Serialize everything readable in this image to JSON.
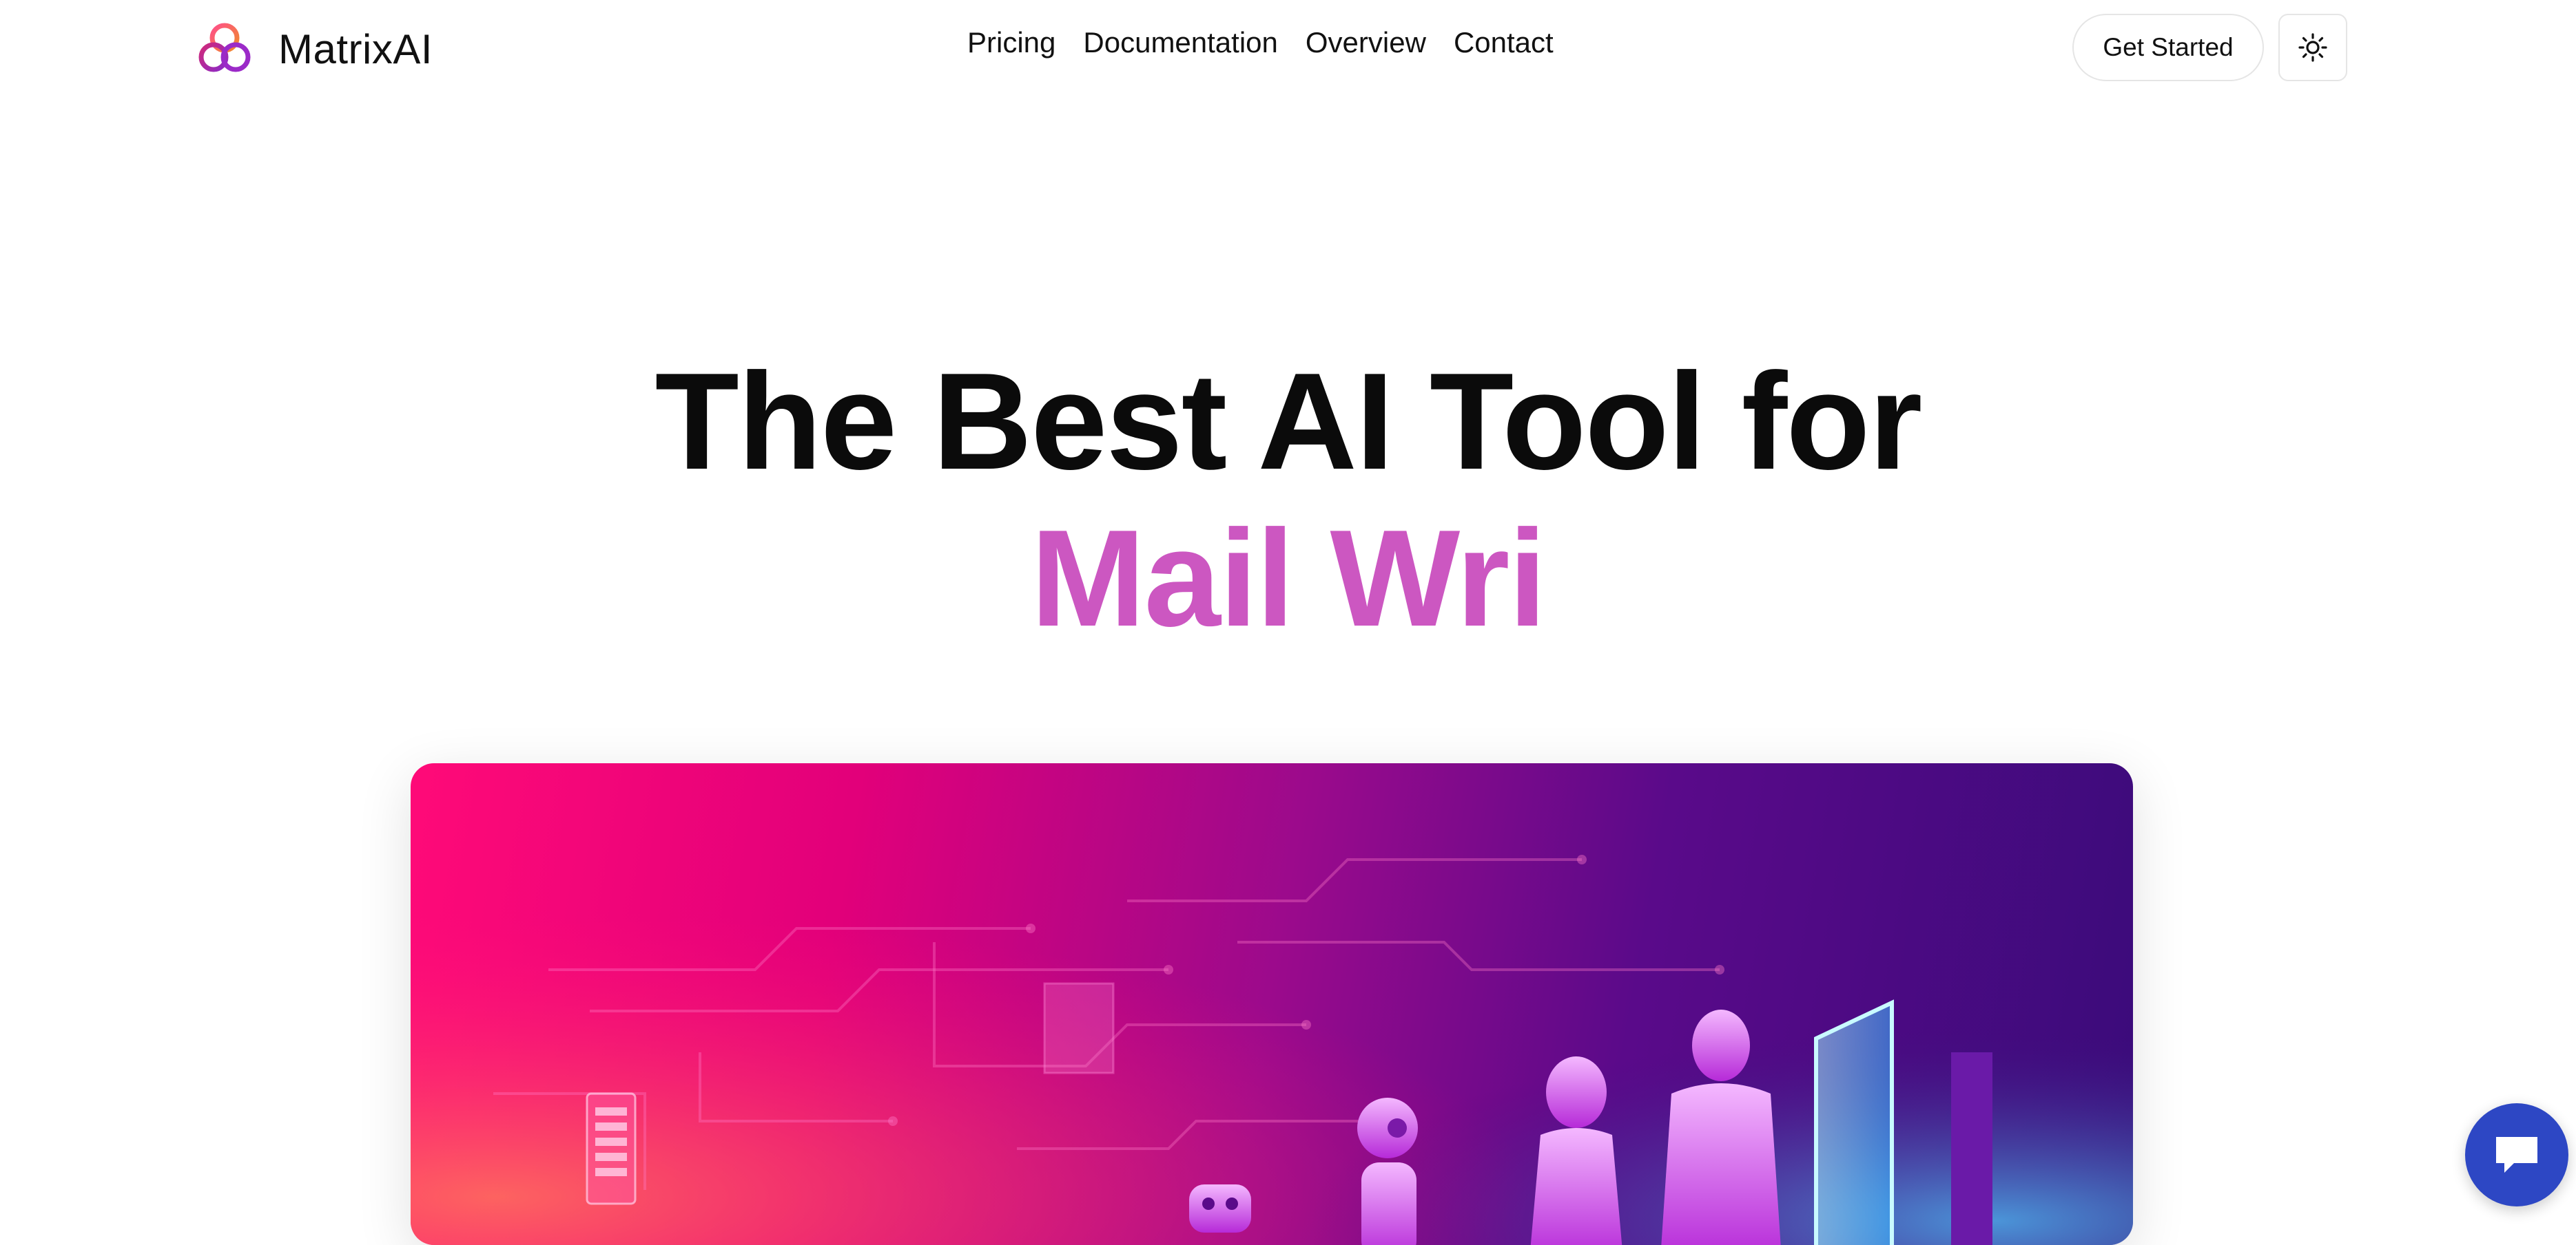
{
  "brand": {
    "name": "MatrixAI"
  },
  "nav": {
    "items": [
      "Pricing",
      "Documentation",
      "Overview",
      "Contact"
    ]
  },
  "header": {
    "cta_label": "Get Started"
  },
  "hero": {
    "line1": "The Best AI Tool for",
    "line2": "Mail Wri"
  },
  "colors": {
    "accent": "#cc57c1",
    "chat_bubble": "#2d47c4"
  },
  "icons": {
    "logo": "triple-ring-logo-icon",
    "theme": "sun-icon",
    "chat": "chat-bubble-icon"
  }
}
